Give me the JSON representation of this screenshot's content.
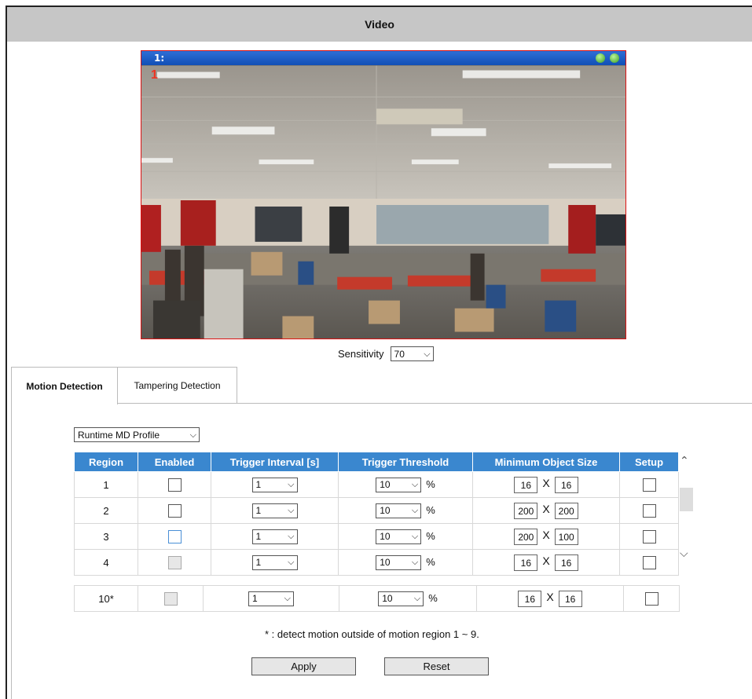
{
  "header": {
    "title": "Video"
  },
  "video": {
    "channel_label": "1:",
    "region_marker": "1"
  },
  "sensitivity": {
    "label": "Sensitivity",
    "value": "70"
  },
  "tabs": [
    {
      "label": "Motion Detection",
      "active": true
    },
    {
      "label": "Tampering Detection",
      "active": false
    }
  ],
  "profile": {
    "value": "Runtime MD Profile"
  },
  "table": {
    "headers": [
      "Region",
      "Enabled",
      "Trigger Interval [s]",
      "Trigger Threshold",
      "Minimum Object Size",
      "Setup"
    ],
    "rows": [
      {
        "region": "1",
        "interval": "1",
        "threshold": "10",
        "min_w": "16",
        "min_h": "16"
      },
      {
        "region": "2",
        "interval": "1",
        "threshold": "10",
        "min_w": "200",
        "min_h": "200"
      },
      {
        "region": "3",
        "interval": "1",
        "threshold": "10",
        "min_w": "200",
        "min_h": "100"
      },
      {
        "region": "4",
        "interval": "1",
        "threshold": "10",
        "min_w": "16",
        "min_h": "16"
      }
    ],
    "percent": "%",
    "times": "X"
  },
  "outside_row": {
    "region": "10*",
    "interval": "1",
    "threshold": "10",
    "min_w": "16",
    "min_h": "16"
  },
  "note": "* : detect motion outside of motion region 1 ~ 9.",
  "buttons": {
    "apply": "Apply",
    "reset": "Reset"
  }
}
